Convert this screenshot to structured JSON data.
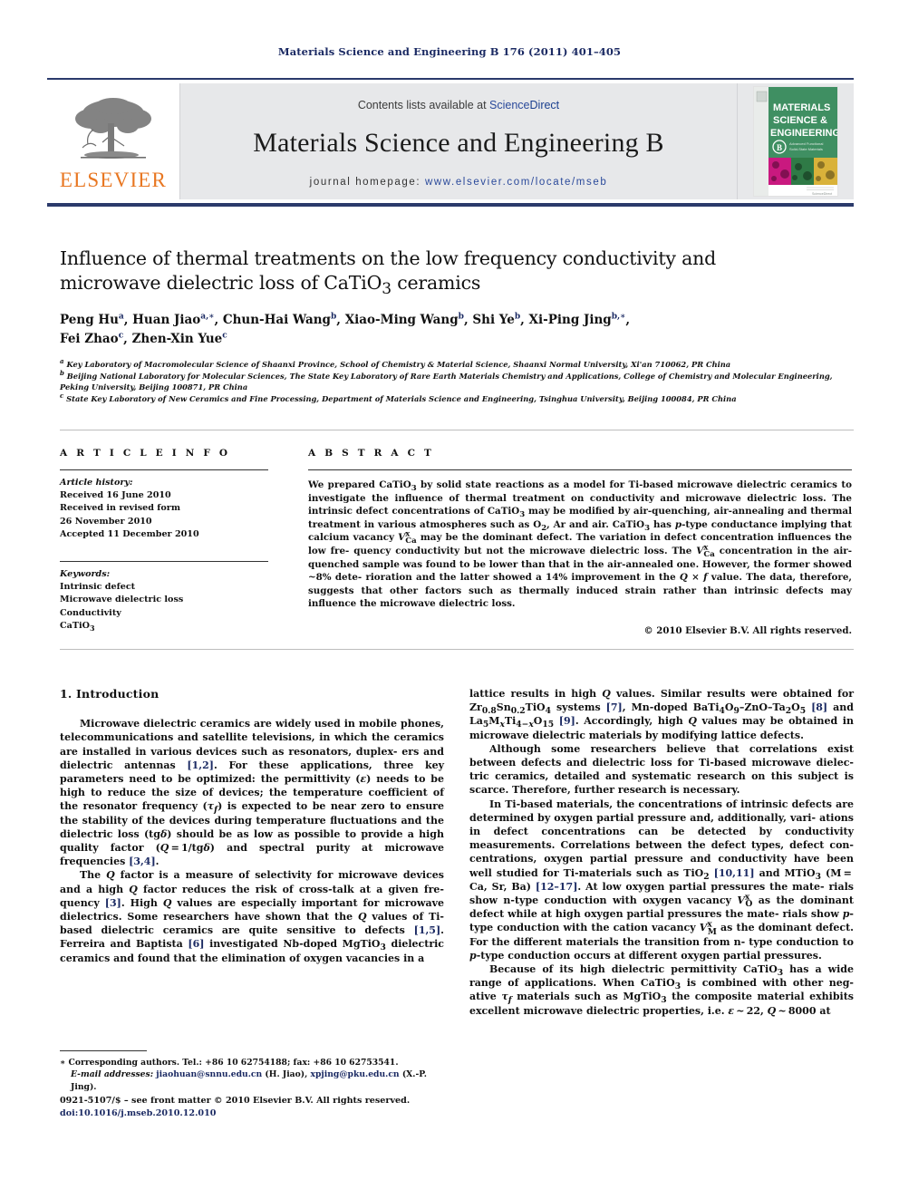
{
  "running_head": "Materials Science and Engineering B 176 (2011) 401–405",
  "masthead": {
    "contents_prefix": "Contents lists available at ",
    "contents_link_a": "Science",
    "contents_link_b": "Direct",
    "journal_title": "Materials Science and Engineering B",
    "homepage_label": "journal homepage:",
    "homepage_url": "www.elsevier.com/locate/mseb",
    "publisher_logo_text": "ELSEVIER",
    "cover": {
      "line1": "MATERIALS",
      "line2": "SCIENCE &",
      "line3": "ENGINEERING",
      "badge": "B",
      "badge_sub1": "Advanced Functional",
      "badge_sub2": "Solid-State Materials"
    },
    "rule_color": "#2b3a6b",
    "panel_bg": "#e7e8ea",
    "link_color": "#2b4a9b",
    "logo_color": "#E87722"
  },
  "article": {
    "title_line1": "Influence of thermal treatments on the low frequency conductivity and",
    "title_line2_pre": "microwave dielectric loss of CaTiO",
    "title_line2_sub": "3",
    "title_line2_post": " ceramics",
    "authors": [
      {
        "name": "Peng Hu",
        "sup": "a",
        "sep": ", "
      },
      {
        "name": "Huan Jiao",
        "sup": "a,∗",
        "sep": ", "
      },
      {
        "name": "Chun-Hai Wang",
        "sup": "b",
        "sep": ", "
      },
      {
        "name": "Xiao-Ming Wang",
        "sup": "b",
        "sep": ", "
      },
      {
        "name": "Shi Ye",
        "sup": "b",
        "sep": ", "
      },
      {
        "name": "Xi-Ping Jing",
        "sup": "b,∗",
        "sep": ","
      },
      {
        "name": "Fei Zhao",
        "sup": "c",
        "sep": ", "
      },
      {
        "name": "Zhen-Xin Yue",
        "sup": "c",
        "sep": ""
      }
    ],
    "affiliations": [
      {
        "marker": "a",
        "text": "Key Laboratory of Macromolecular Science of Shaanxi Province, School of Chemistry & Material Science, Shaanxi Normal University, Xi'an 710062, PR China"
      },
      {
        "marker": "b",
        "text": "Beijing National Laboratory for Molecular Sciences, The State Key Laboratory of Rare Earth Materials Chemistry and Applications, College of Chemistry and Molecular Engineering, Peking University, Beijing 100871, PR China"
      },
      {
        "marker": "c",
        "text": "State Key Laboratory of New Ceramics and Fine Processing, Department of Materials Science and Engineering, Tsinghua University, Beijing 100084, PR China"
      }
    ]
  },
  "article_info": {
    "heading": "A R T I C L E    I N F O",
    "history_label": "Article history:",
    "history": [
      "Received 16 June 2010",
      "Received in revised form",
      "26 November 2010",
      "Accepted 11 December 2010"
    ],
    "keywords_label": "Keywords:",
    "keywords": [
      "Intrinsic defect",
      "Microwave dielectric loss",
      "Conductivity",
      "CaTiO3"
    ]
  },
  "abstract": {
    "heading": "A B S T R A C T",
    "copyright": "© 2010 Elsevier B.V. All rights reserved."
  },
  "body": {
    "section1_heading": "1.  Introduction"
  },
  "footnote": {
    "star": "∗",
    "corresponding": " Corresponding authors. Tel.: +86 10 62754188; fax: +86 10 62753541.",
    "email_label": "E-mail addresses:",
    "email1": "jiaohuan@snnu.edu.cn",
    "email1_owner": " (H. Jiao),",
    "email2": "xpjing@pku.edu.cn",
    "email2_owner": " (X.-P. Jing)."
  },
  "bottom": {
    "issn_line_black": "0921-5107/$ – see front matter ",
    "issn_line_rest": "© 2010 Elsevier B.V. All rights reserved.",
    "doi": "doi:10.1016/j.mseb.2010.12.010"
  }
}
